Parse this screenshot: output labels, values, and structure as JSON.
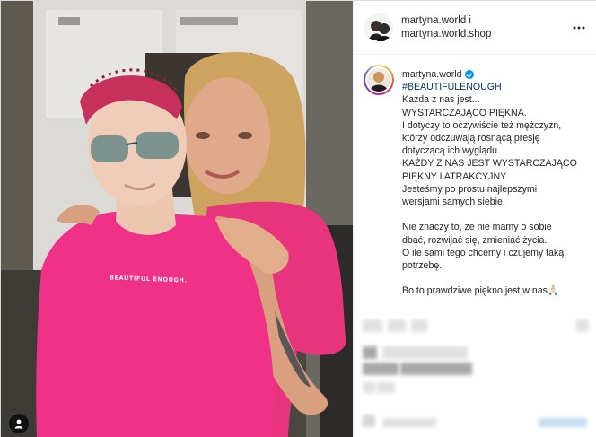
{
  "header": {
    "line1": "martyna.world i",
    "line2": "martyna.world.shop",
    "more_icon": "more-horizontal-icon"
  },
  "caption": {
    "username": "martyna.world",
    "hashtag": "#BEAUTIFULENOUGH",
    "lines": [
      "Każda z nas jest...",
      "WYSTARCZAJĄCO PIĘKNA.",
      "I dotyczy to oczywiście też mężczyzn,",
      "którzy odczuwają rosnącą presję",
      "dotyczącą ich wyglądu.",
      "KAŻDY Z NAS JEST WYSTARCZAJĄCO",
      "PIĘKNY I ATRAKCYJNY.",
      "Jesteśmy po prostu najlepszymi",
      "wersjami samych siebie."
    ],
    "lines2": [
      "Nie znaczy to, że nie mamy o sobie",
      "dbać, rozwijać się, zmieniać życia.",
      "O ile sami tego chcemy i czujemy taką",
      "potrzebę."
    ],
    "lines3": [
      "Bo to prawdziwe piękno jest w nas🙏🏻"
    ]
  },
  "photo": {
    "shirt_text": "BEAUTIFUL ENOUGH.",
    "tag_icon": "user-tag-icon"
  },
  "colors": {
    "pink_shirt": "#ee2f86",
    "link": "#00376b",
    "verified": "#0095f6"
  }
}
